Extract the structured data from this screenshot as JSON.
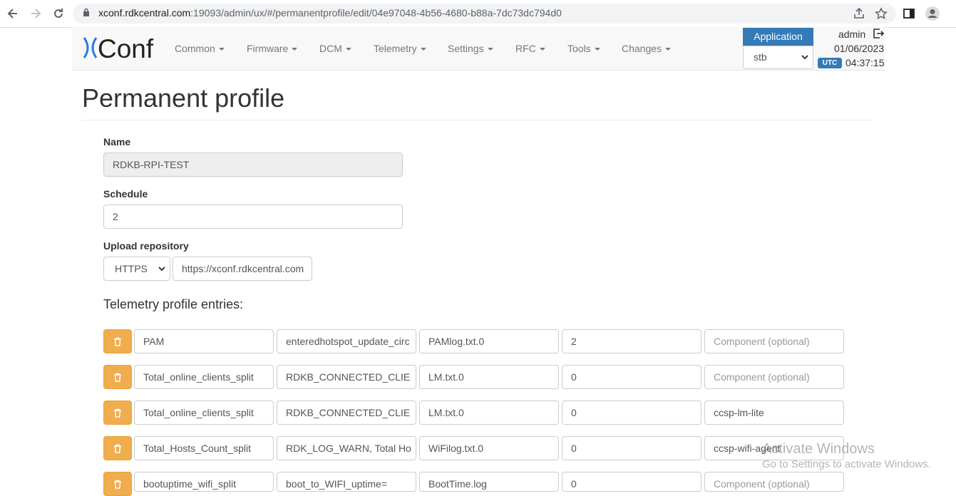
{
  "browser": {
    "url_host": "xconf.rdkcentral.com",
    "url_rest": ":19093/admin/ux/#/permanentprofile/edit/04e97048-4b56-4680-b88a-7dc73dc794d0"
  },
  "navbar": {
    "logo_text": "Conf",
    "menu": [
      {
        "label": "Common"
      },
      {
        "label": "Firmware"
      },
      {
        "label": "DCM"
      },
      {
        "label": "Telemetry"
      },
      {
        "label": "Settings"
      },
      {
        "label": "RFC"
      },
      {
        "label": "Tools"
      },
      {
        "label": "Changes"
      }
    ],
    "application_label": "Application",
    "application_value": "stb",
    "user": "admin",
    "date": "01/06/2023",
    "tz_badge": "UTC",
    "time": "04:37:15"
  },
  "page": {
    "title": "Permanent profile",
    "name_label": "Name",
    "name_value": "RDKB-RPI-TEST",
    "schedule_label": "Schedule",
    "schedule_value": "2",
    "upload_label": "Upload repository",
    "protocol_value": "HTTPS",
    "repo_value": "https://xconf.rdkcentral.com",
    "entries_heading": "Telemetry profile entries:",
    "entries": [
      {
        "header": "PAM",
        "content": "enteredhotspot_update_circ",
        "type": "PAMlog.txt.0",
        "polling": "2",
        "component": "",
        "component_placeholder": "Component (optional)"
      },
      {
        "header": "Total_online_clients_split",
        "content": "RDKB_CONNECTED_CLIE",
        "type": "LM.txt.0",
        "polling": "0",
        "component": "",
        "component_placeholder": "Component (optional)"
      },
      {
        "header": "Total_online_clients_split",
        "content": "RDKB_CONNECTED_CLIE",
        "type": "LM.txt.0",
        "polling": "0",
        "component": "ccsp-lm-lite",
        "component_placeholder": ""
      },
      {
        "header": "Total_Hosts_Count_split",
        "content": "RDK_LOG_WARN, Total Ho",
        "type": "WiFilog.txt.0",
        "polling": "0",
        "component": "ccsp-wifi-agent",
        "component_placeholder": ""
      },
      {
        "header": "bootuptime_wifi_split",
        "content": "boot_to_WIFI_uptime=",
        "type": "BootTime.log",
        "polling": "0",
        "component": "",
        "component_placeholder": "Component (optional)"
      }
    ]
  },
  "watermark": {
    "line1": "Activate Windows",
    "line2": "Go to Settings to activate Windows."
  },
  "colors": {
    "primary": "#337ab7",
    "warning": "#f0ad4e",
    "logo_blue": "#2a7ae2"
  }
}
